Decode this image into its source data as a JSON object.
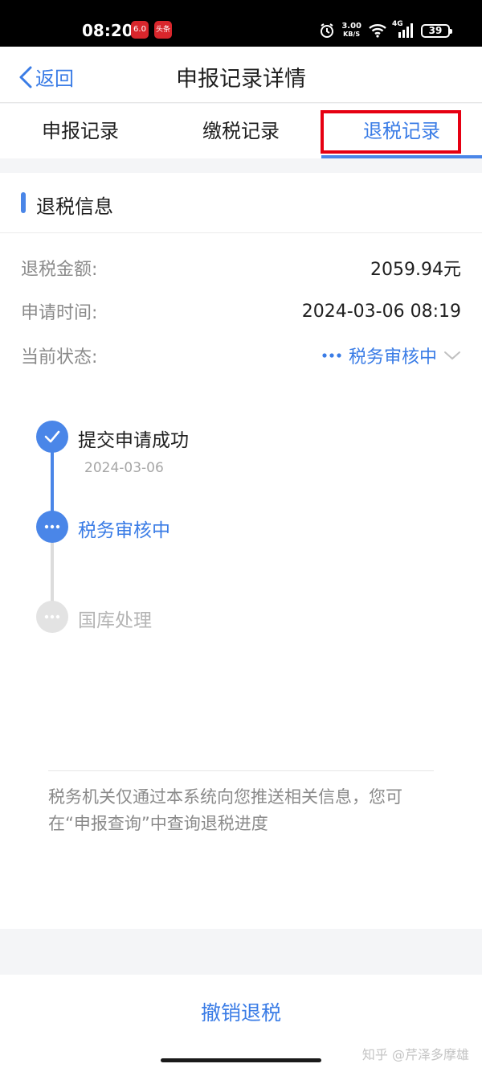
{
  "status_bar": {
    "time": "08:20",
    "badge1": "6.0",
    "badge2": "头条",
    "net_speed_value": "3.00",
    "net_speed_unit": "KB/S",
    "network": "4G",
    "battery": "39"
  },
  "header": {
    "back_label": "返回",
    "title": "申报记录详情"
  },
  "tabs": [
    {
      "label": "申报记录",
      "active": false
    },
    {
      "label": "缴税记录",
      "active": false
    },
    {
      "label": "退税记录",
      "active": true
    }
  ],
  "section": {
    "title": "退税信息"
  },
  "info": {
    "amount_label": "退税金额:",
    "amount_value": "2059.94元",
    "time_label": "申请时间:",
    "time_value": "2024-03-06 08:19",
    "status_label": "当前状态:",
    "status_value": "税务审核中"
  },
  "timeline": [
    {
      "label": "提交申请成功",
      "date": "2024-03-06",
      "state": "done"
    },
    {
      "label": "税务审核中",
      "date": "",
      "state": "current"
    },
    {
      "label": "国库处理",
      "date": "",
      "state": "pending"
    }
  ],
  "notice": "税务机关仅通过本系统向您推送相关信息，您可在“申报查询”中查询退税进度",
  "bottom": {
    "cancel_label": "撤销退税"
  },
  "watermark": "知乎 @芹泽多摩雄",
  "colors": {
    "accent": "#4a86e8",
    "accent_text": "#3a7ce6",
    "highlight_box": "#e60012"
  }
}
